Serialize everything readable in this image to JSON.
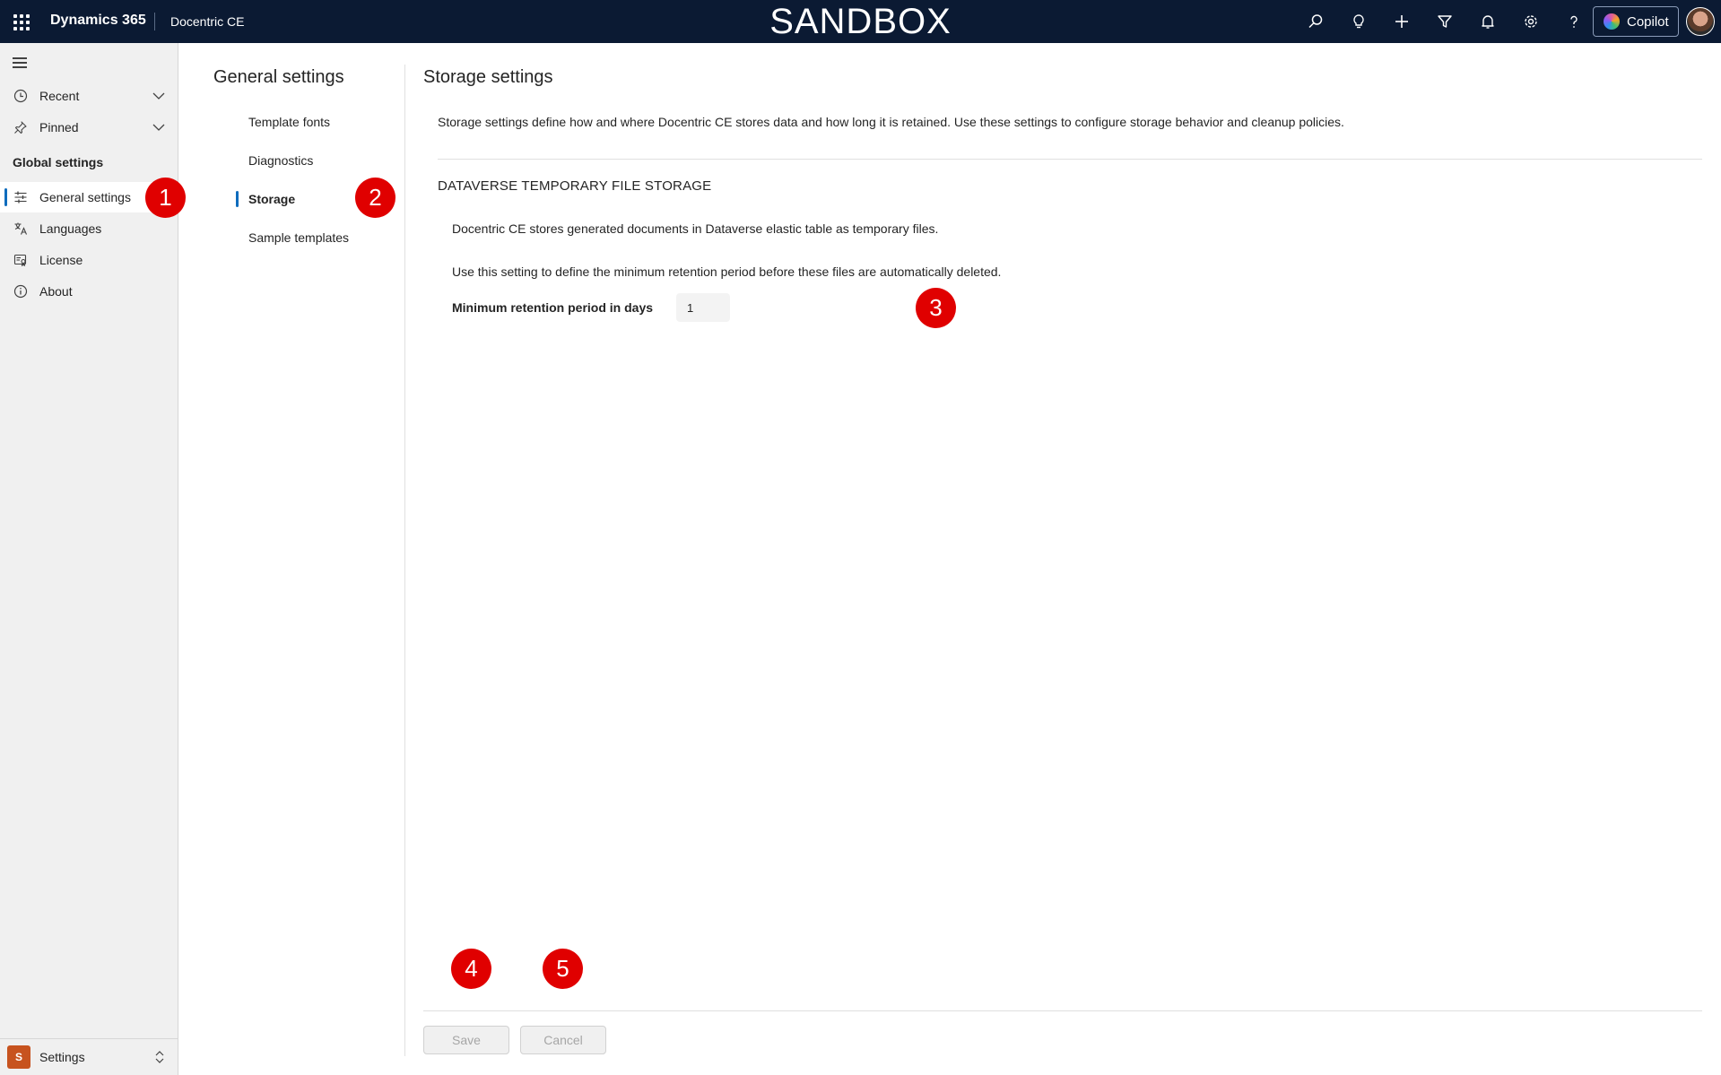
{
  "topbar": {
    "brand": "Dynamics 365",
    "app_name": "Docentric CE",
    "environment_banner": "SANDBOX",
    "icons": [
      "search-icon",
      "lightbulb-icon",
      "plus-icon",
      "filter-icon",
      "bell-icon",
      "gear-icon",
      "help-icon"
    ],
    "copilot_label": "Copilot"
  },
  "leftnav": {
    "recent_label": "Recent",
    "pinned_label": "Pinned",
    "section_title": "Global settings",
    "items": [
      {
        "label": "General settings",
        "icon": "sliders-icon",
        "active": true
      },
      {
        "label": "Languages",
        "icon": "translate-icon",
        "active": false
      },
      {
        "label": "License",
        "icon": "license-icon",
        "active": false
      },
      {
        "label": "About",
        "icon": "info-icon",
        "active": false
      }
    ],
    "area": {
      "badge": "S",
      "label": "Settings"
    }
  },
  "subnav": {
    "title": "General settings",
    "items": [
      {
        "label": "Template fonts",
        "active": false
      },
      {
        "label": "Diagnostics",
        "active": false
      },
      {
        "label": "Storage",
        "active": true
      },
      {
        "label": "Sample templates",
        "active": false
      }
    ]
  },
  "main": {
    "title": "Storage settings",
    "description": "Storage settings define how and where Docentric CE stores data and how long it is retained. Use these settings to configure storage behavior and cleanup policies.",
    "section_title": "DATAVERSE TEMPORARY FILE STORAGE",
    "paragraph_1": "Docentric CE stores generated documents in Dataverse elastic table as temporary files.",
    "paragraph_2": "Use this setting to define the minimum retention period before these files are automatically deleted.",
    "retention_label": "Minimum retention period in days",
    "retention_value": "1",
    "save_label": "Save",
    "cancel_label": "Cancel"
  },
  "markers": [
    "1",
    "2",
    "3",
    "4",
    "5"
  ],
  "colors": {
    "topbar_bg": "#0b1a33",
    "accent": "#0f6cbd",
    "marker": "#e00000",
    "area_badge": "#c7531f"
  }
}
